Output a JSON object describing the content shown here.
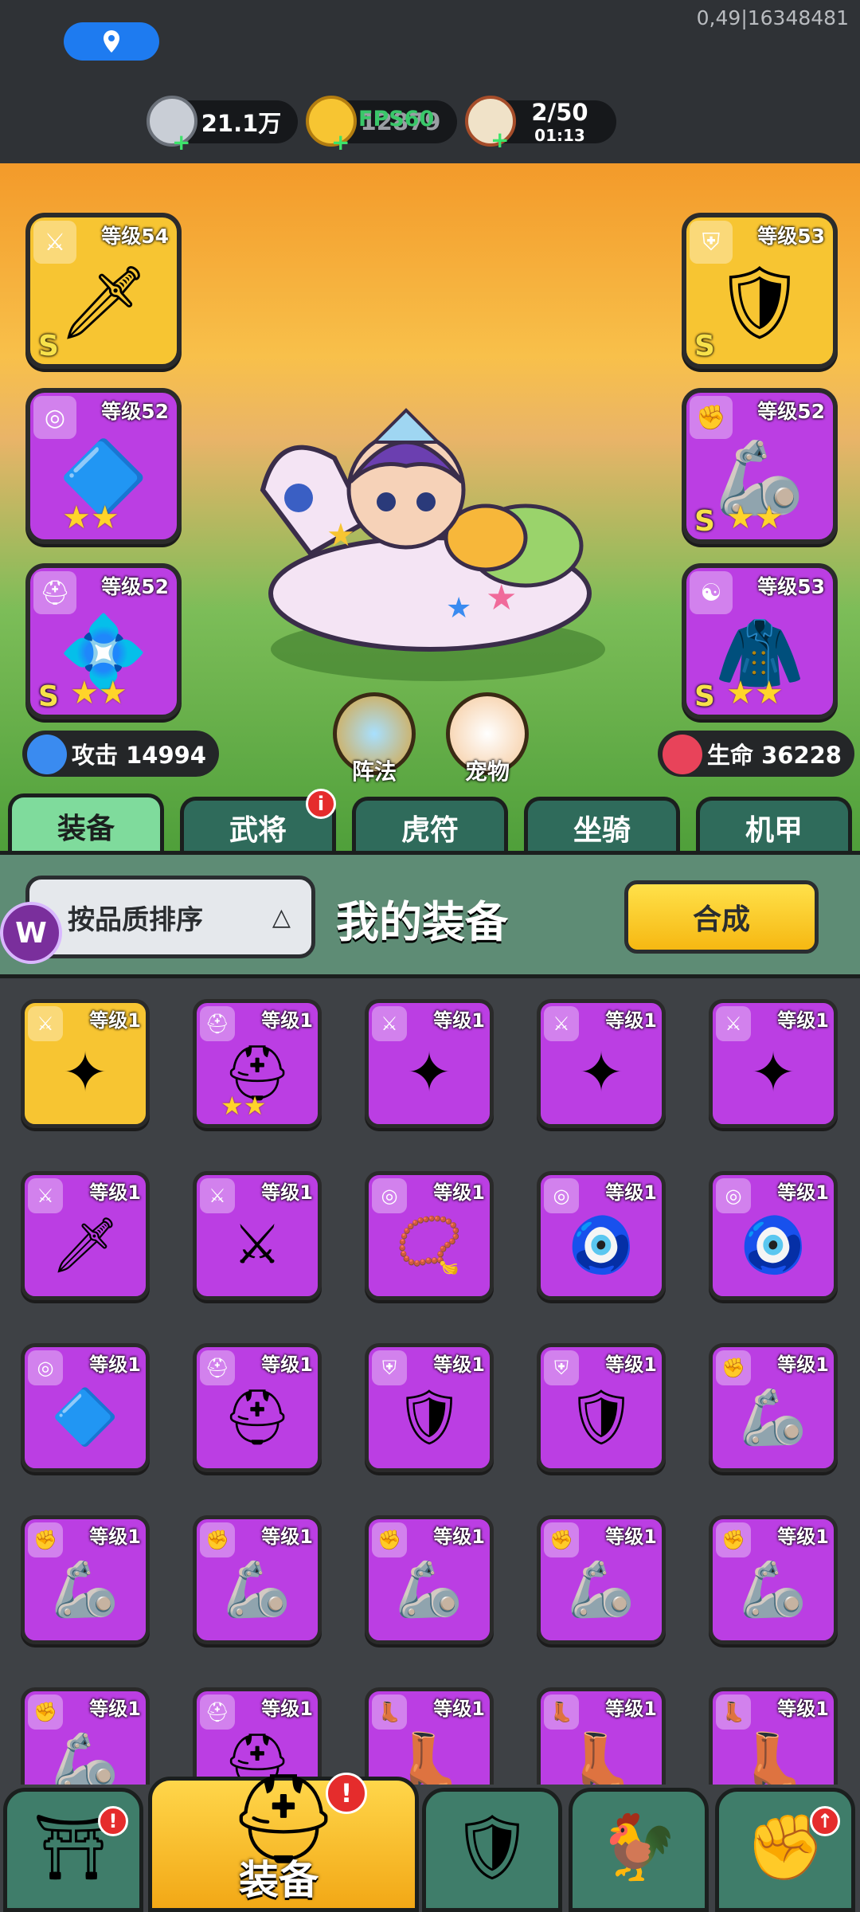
{
  "status": {
    "debug_text": "0,49|16348481"
  },
  "resources": [
    {
      "icon": "silver-coin-icon",
      "value": "21.1万"
    },
    {
      "icon": "gold-ingot-icon",
      "value": "12879",
      "overlay": "FPS60"
    },
    {
      "icon": "meat-stamina-icon",
      "value": "2/50",
      "timer": "01:13"
    }
  ],
  "equipment_slots": {
    "left": [
      {
        "level": "等级54",
        "grade": "S",
        "stars": "",
        "type": "sword-icon",
        "bg": "gold"
      },
      {
        "level": "等级52",
        "grade": "",
        "stars": "★★",
        "type": "amulet-icon",
        "bg": "purple"
      },
      {
        "level": "等级52",
        "grade": "S",
        "stars": "★★",
        "type": "helmet-icon",
        "bg": "purple"
      }
    ],
    "right": [
      {
        "level": "等级53",
        "grade": "S",
        "stars": "",
        "type": "armor-icon",
        "bg": "gold"
      },
      {
        "level": "等级52",
        "grade": "S",
        "stars": "★★",
        "type": "gauntlet-icon",
        "bg": "purple"
      },
      {
        "level": "等级53",
        "grade": "S",
        "stars": "★★",
        "type": "yinyang-icon",
        "bg": "purple"
      }
    ]
  },
  "stats": {
    "attack": "攻击 14994",
    "hp": "生命 36228"
  },
  "center_buttons": {
    "formation": "阵法",
    "pet": "宠物"
  },
  "tabs": [
    {
      "label": "装备",
      "active": true,
      "badge": ""
    },
    {
      "label": "武将",
      "active": false,
      "badge": "i"
    },
    {
      "label": "虎符",
      "active": false,
      "badge": ""
    },
    {
      "label": "坐骑",
      "active": false,
      "badge": ""
    },
    {
      "label": "机甲",
      "active": false,
      "badge": ""
    }
  ],
  "panel": {
    "sort_label": "按品质排序",
    "sort_arrow": "△",
    "title": "我的装备",
    "synthesize": "合成",
    "logo": "W"
  },
  "inventory": [
    {
      "level": "等级1",
      "type": "shuriken",
      "bg": "gold",
      "stars": ""
    },
    {
      "level": "等级1",
      "type": "helmet",
      "bg": "purple",
      "stars": "★★"
    },
    {
      "level": "等级1",
      "type": "shuriken",
      "bg": "purple",
      "stars": ""
    },
    {
      "level": "等级1",
      "type": "shuriken",
      "bg": "purple",
      "stars": ""
    },
    {
      "level": "等级1",
      "type": "shuriken",
      "bg": "purple",
      "stars": ""
    },
    {
      "level": "等级1",
      "type": "dagger",
      "bg": "purple",
      "stars": ""
    },
    {
      "level": "等级1",
      "type": "blade",
      "bg": "purple",
      "stars": ""
    },
    {
      "level": "等级1",
      "type": "necklace",
      "bg": "purple",
      "stars": ""
    },
    {
      "level": "等级1",
      "type": "talisman",
      "bg": "purple",
      "stars": ""
    },
    {
      "level": "等级1",
      "type": "talisman",
      "bg": "purple",
      "stars": ""
    },
    {
      "level": "等级1",
      "type": "amulet",
      "bg": "purple",
      "stars": ""
    },
    {
      "level": "等级1",
      "type": "helmet",
      "bg": "purple",
      "stars": ""
    },
    {
      "level": "等级1",
      "type": "armor",
      "bg": "purple",
      "stars": ""
    },
    {
      "level": "等级1",
      "type": "armor",
      "bg": "purple",
      "stars": ""
    },
    {
      "level": "等级1",
      "type": "gauntlet",
      "bg": "purple",
      "stars": ""
    },
    {
      "level": "等级1",
      "type": "gauntlet",
      "bg": "purple",
      "stars": ""
    },
    {
      "level": "等级1",
      "type": "gauntlet",
      "bg": "purple",
      "stars": ""
    },
    {
      "level": "等级1",
      "type": "gauntlet",
      "bg": "purple",
      "stars": ""
    },
    {
      "level": "等级1",
      "type": "gauntlet",
      "bg": "purple",
      "stars": ""
    },
    {
      "level": "等级1",
      "type": "gauntlet",
      "bg": "purple",
      "stars": ""
    },
    {
      "level": "等级1",
      "type": "gauntlet",
      "bg": "purple",
      "stars": ""
    },
    {
      "level": "等级1",
      "type": "helmet",
      "bg": "purple",
      "stars": ""
    },
    {
      "level": "等级1",
      "type": "boots",
      "bg": "purple",
      "stars": ""
    },
    {
      "level": "等级1",
      "type": "boots",
      "bg": "purple",
      "stars": ""
    },
    {
      "level": "等级1",
      "type": "boots",
      "bg": "purple",
      "stars": ""
    }
  ],
  "nav": {
    "active_label": "装备",
    "items": [
      "shop-gate-icon",
      "equipment-helmet-icon",
      "battle-shield-icon",
      "rooster-gacha-icon",
      "fist-upgrade-icon"
    ]
  },
  "colors": {
    "gold_slot": "#f7c532",
    "purple_slot": "#bb3ee3",
    "tab_active": "#7fdb9c",
    "panel": "#5e8c75"
  }
}
